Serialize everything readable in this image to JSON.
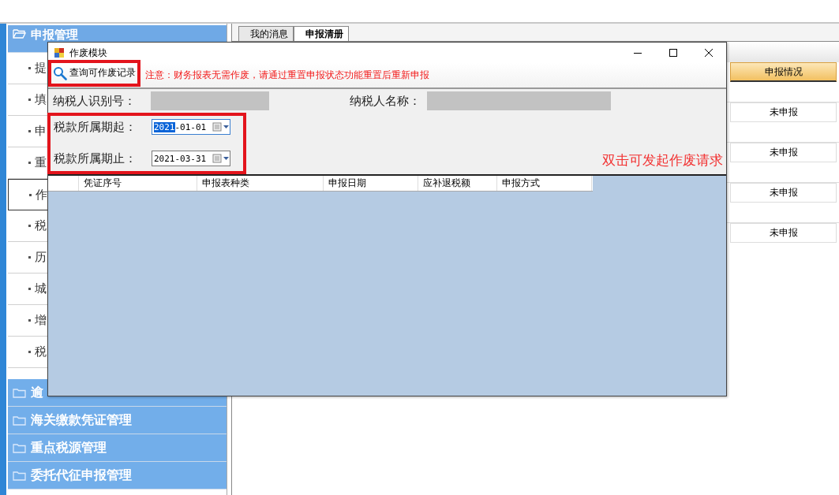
{
  "sidebar": {
    "groups": [
      {
        "label": "申报管理",
        "expanded": true,
        "items": [
          {
            "label": "提",
            "selected": false
          },
          {
            "label": "填",
            "selected": false
          },
          {
            "label": "申",
            "selected": false
          },
          {
            "label": "重",
            "selected": false
          },
          {
            "label": "作",
            "selected": true
          },
          {
            "label": "税",
            "selected": false
          },
          {
            "label": "历",
            "selected": false
          },
          {
            "label": "城",
            "selected": false
          },
          {
            "label": "增",
            "selected": false
          },
          {
            "label": "税",
            "selected": false
          }
        ]
      },
      {
        "label": "逾",
        "expanded": false
      },
      {
        "label": "海关缴款凭证管理",
        "expanded": false
      },
      {
        "label": "重点税源管理",
        "expanded": false
      },
      {
        "label": "委托代征申报管理",
        "expanded": false
      }
    ]
  },
  "tabs": [
    {
      "label": "我的消息",
      "selected": false
    },
    {
      "label": "申报清册",
      "selected": true
    }
  ],
  "declaration_list": {
    "columns": [
      "申报情况"
    ],
    "rows": [
      {
        "status": "未申报"
      },
      {
        "status": "未申报"
      },
      {
        "status": "未申报"
      },
      {
        "status": "未申报"
      }
    ]
  },
  "dialog": {
    "title": "作废模块",
    "toolbar": {
      "query_button": {
        "label": "查询可作废记录",
        "highlighted": true
      },
      "notice": "注意：财务报表无需作废，请通过重置申报状态功能重置后重新申报"
    },
    "form": {
      "taxpayer_id_label": "纳税人识别号：",
      "taxpayer_name_label": "纳税人名称：",
      "date_range": {
        "highlighted": true,
        "fields": [
          {
            "label": "税款所属期起：",
            "value": "2021-01-01",
            "focused": true
          },
          {
            "label": "税款所属期止：",
            "value": "2021-03-31",
            "focused": false
          }
        ]
      },
      "hint": "双击可发起作废请求"
    },
    "table": {
      "columns": [
        "",
        "凭证序号",
        "申报表种类",
        "申报日期",
        "应补退税额",
        "申报方式"
      ]
    }
  }
}
